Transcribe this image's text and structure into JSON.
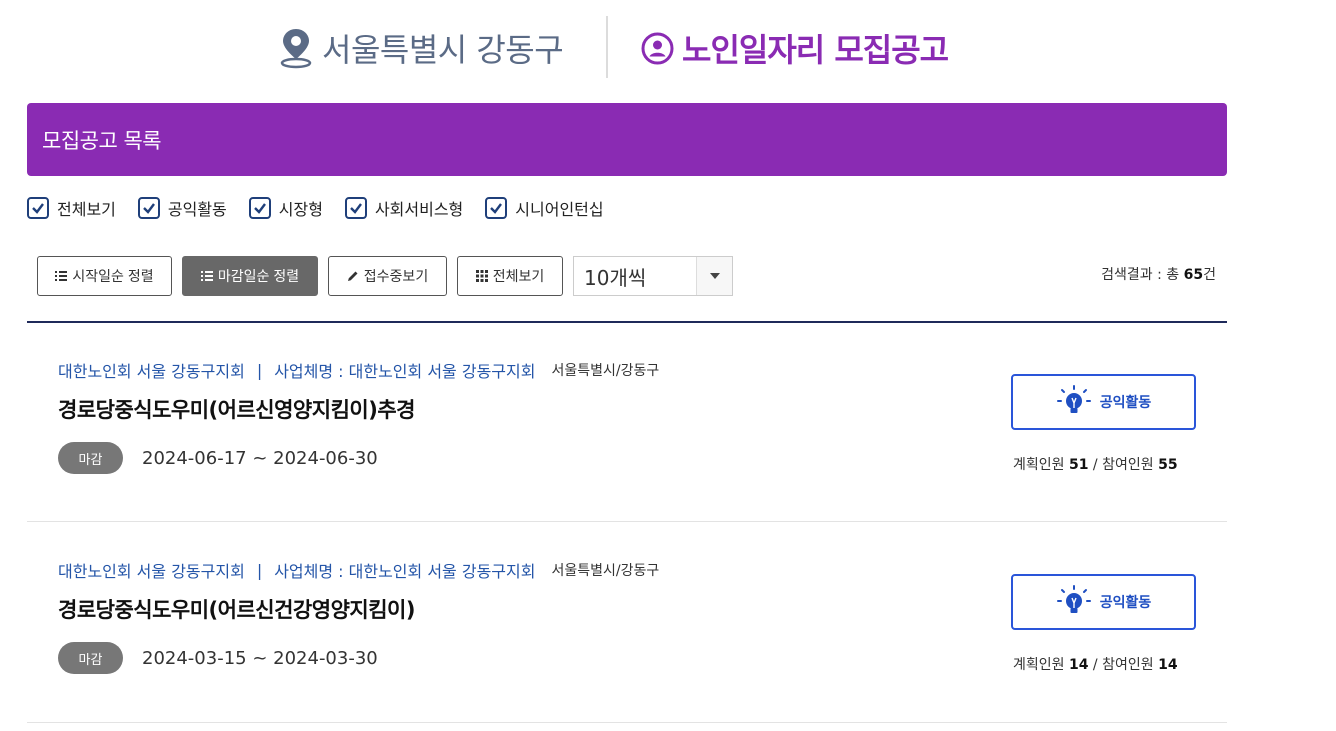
{
  "header": {
    "region": "서울특별시 강동구",
    "title": "노인일자리 모집공고",
    "pin_icon": "location-pin-icon",
    "person_icon": "user-circle-icon"
  },
  "banner": {
    "title": "모집공고 목록"
  },
  "filters": [
    {
      "label": "전체보기",
      "checked": true
    },
    {
      "label": "공익활동",
      "checked": true
    },
    {
      "label": "시장형",
      "checked": true
    },
    {
      "label": "사회서비스형",
      "checked": true
    },
    {
      "label": "시니어인턴십",
      "checked": true
    }
  ],
  "toolbar": {
    "sort_start": "시작일순 정렬",
    "sort_deadline": "마감일순 정렬",
    "receiving": "접수중보기",
    "view_all": "전체보기",
    "page_size": "10개씩"
  },
  "result": {
    "prefix": "검색결과 : 총 ",
    "count": "65",
    "suffix": "건"
  },
  "jobs": [
    {
      "org": "대한노인회 서울 강동구지회",
      "separator": "|",
      "operator": "사업체명 : 대한노인회 서울 강동구지회",
      "location": "서울특별시/강동구",
      "title": "경로당중식도우미(어르신영양지킴이)추경",
      "status": "마감",
      "period": "2024-06-17 ~ 2024-06-30",
      "category": "공익활동",
      "planned_label": "계획인원",
      "planned": "51",
      "slash": "/",
      "participants_label": "참여인원",
      "participants": "55"
    },
    {
      "org": "대한노인회 서울 강동구지회",
      "separator": "|",
      "operator": "사업체명 : 대한노인회 서울 강동구지회",
      "location": "서울특별시/강동구",
      "title": "경로당중식도우미(어르신건강영양지킴이)",
      "status": "마감",
      "period": "2024-03-15 ~ 2024-03-30",
      "category": "공익활동",
      "planned_label": "계획인원",
      "planned": "14",
      "slash": "/",
      "participants_label": "참여인원",
      "participants": "14"
    }
  ],
  "colors": {
    "brand_purple": "#8a2bb3",
    "link_blue": "#2455a8",
    "category_blue": "#2a55d9",
    "badge_gray": "#777777"
  }
}
